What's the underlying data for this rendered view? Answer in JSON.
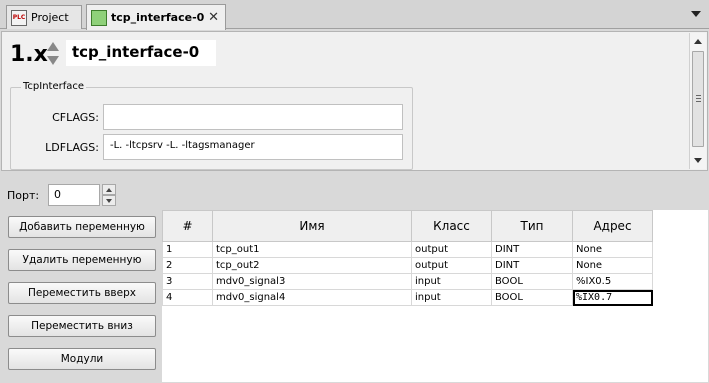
{
  "tabs": [
    {
      "label": "Project",
      "icon": "plc-icon",
      "active": false
    },
    {
      "label": "tcp_interface-0",
      "icon": "module-icon",
      "active": true
    }
  ],
  "plc_icon_text": "PLC",
  "close_glyph": "✕",
  "header": {
    "version": "1.x",
    "name": "tcp_interface-0"
  },
  "group": {
    "title": "TcpInterface",
    "cflags_label": "CFLAGS:",
    "cflags_value": "",
    "ldflags_label": "LDFLAGS:",
    "ldflags_value": "-L. -ltcpsrv -L. -ltagsmanager"
  },
  "port": {
    "label": "Порт:",
    "value": "0"
  },
  "buttons": {
    "add": "Добавить переменную",
    "delete": "Удалить переменную",
    "move_up": "Переместить вверх",
    "move_down": "Переместить вниз",
    "modules": "Модули"
  },
  "table": {
    "headers": [
      "#",
      "Имя",
      "Класс",
      "Тип",
      "Адрес"
    ],
    "rows": [
      [
        "1",
        "tcp_out1",
        "output",
        "DINT",
        "None"
      ],
      [
        "2",
        "tcp_out2",
        "output",
        "DINT",
        "None"
      ],
      [
        "3",
        "mdv0_signal3",
        "input",
        "BOOL",
        "%IX0.5"
      ],
      [
        "4",
        "mdv0_signal4",
        "input",
        "BOOL",
        "%IX0.7"
      ]
    ]
  },
  "colors": {
    "selected_cell_border": "#000000",
    "module_icon": "#8fd17a"
  }
}
